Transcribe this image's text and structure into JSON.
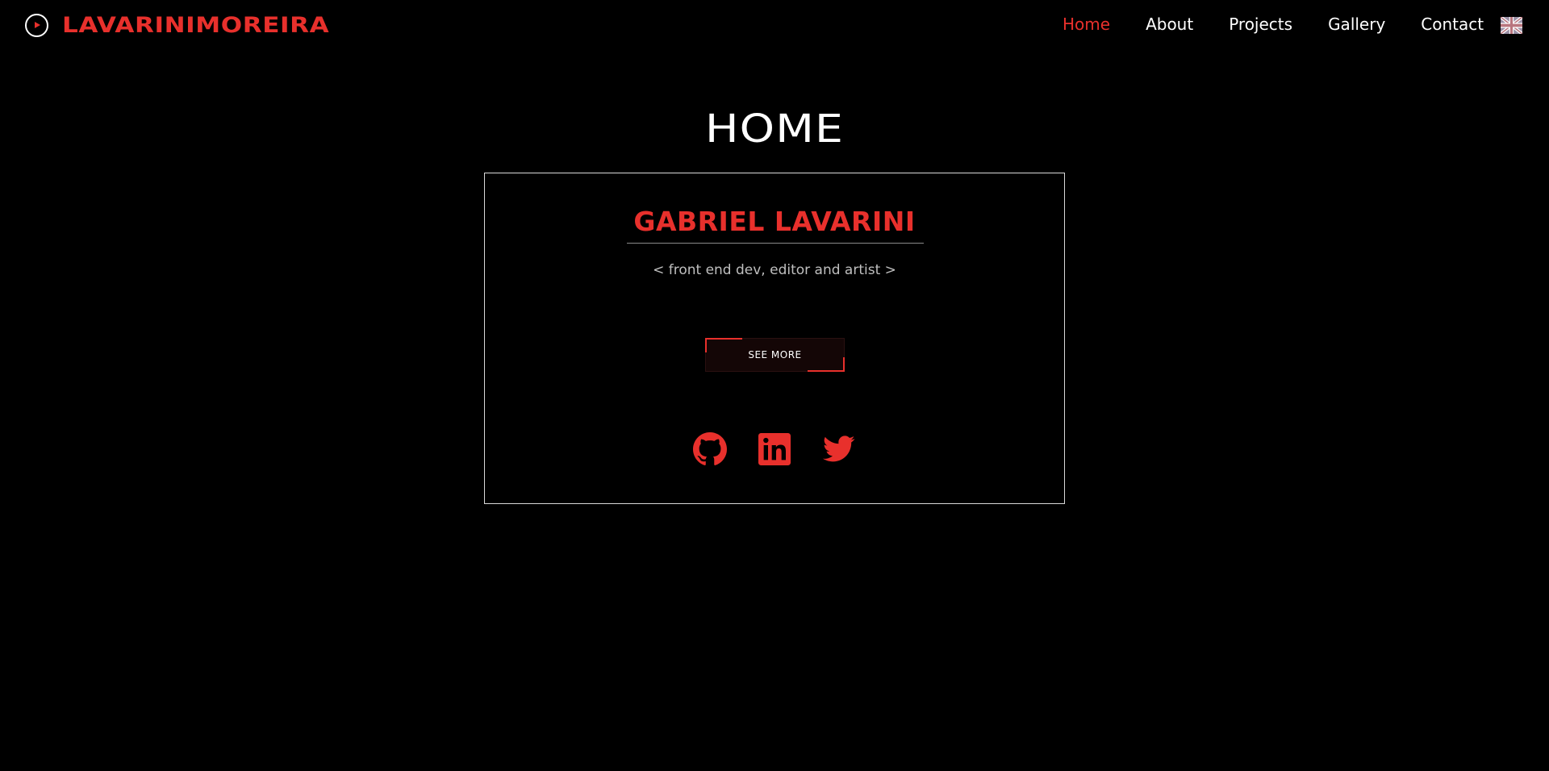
{
  "header": {
    "brand": "LAVARINIMOREIRA",
    "brand_icon": "play-circle-icon",
    "nav": [
      "Home",
      "About",
      "Projects",
      "Gallery",
      "Contact"
    ],
    "active_nav": "Home",
    "language_icon": "uk-flag-icon"
  },
  "main": {
    "title": "HOME",
    "card": {
      "name": "GABRIEL LAVARINI",
      "tagline": "< front end dev, editor and artist >",
      "button_label": "SEE MORE",
      "socials": [
        "github-icon",
        "linkedin-icon",
        "twitter-icon"
      ]
    }
  },
  "colors": {
    "accent": "#e8302c",
    "background": "#000000",
    "text": "#ffffff",
    "muted": "#bfbfbf"
  }
}
